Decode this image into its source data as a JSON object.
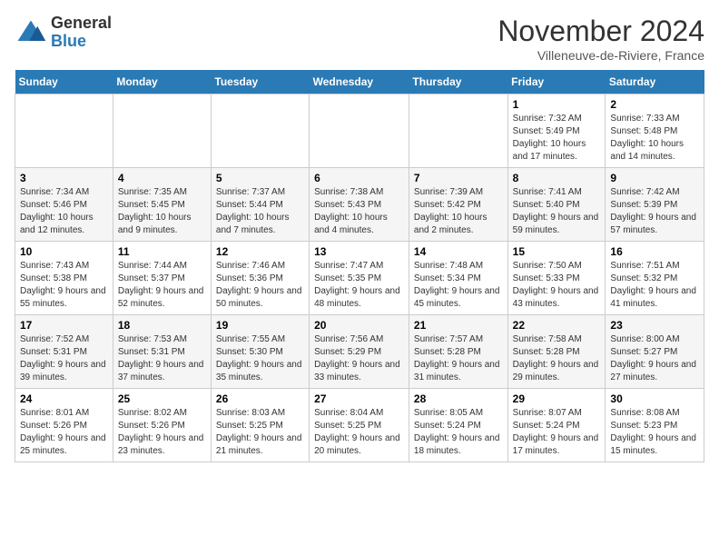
{
  "header": {
    "logo_general": "General",
    "logo_blue": "Blue",
    "month_title": "November 2024",
    "subtitle": "Villeneuve-de-Riviere, France"
  },
  "columns": [
    "Sunday",
    "Monday",
    "Tuesday",
    "Wednesday",
    "Thursday",
    "Friday",
    "Saturday"
  ],
  "weeks": [
    {
      "days": [
        {
          "num": "",
          "info": ""
        },
        {
          "num": "",
          "info": ""
        },
        {
          "num": "",
          "info": ""
        },
        {
          "num": "",
          "info": ""
        },
        {
          "num": "",
          "info": ""
        },
        {
          "num": "1",
          "info": "Sunrise: 7:32 AM\nSunset: 5:49 PM\nDaylight: 10 hours and 17 minutes."
        },
        {
          "num": "2",
          "info": "Sunrise: 7:33 AM\nSunset: 5:48 PM\nDaylight: 10 hours and 14 minutes."
        }
      ]
    },
    {
      "days": [
        {
          "num": "3",
          "info": "Sunrise: 7:34 AM\nSunset: 5:46 PM\nDaylight: 10 hours and 12 minutes."
        },
        {
          "num": "4",
          "info": "Sunrise: 7:35 AM\nSunset: 5:45 PM\nDaylight: 10 hours and 9 minutes."
        },
        {
          "num": "5",
          "info": "Sunrise: 7:37 AM\nSunset: 5:44 PM\nDaylight: 10 hours and 7 minutes."
        },
        {
          "num": "6",
          "info": "Sunrise: 7:38 AM\nSunset: 5:43 PM\nDaylight: 10 hours and 4 minutes."
        },
        {
          "num": "7",
          "info": "Sunrise: 7:39 AM\nSunset: 5:42 PM\nDaylight: 10 hours and 2 minutes."
        },
        {
          "num": "8",
          "info": "Sunrise: 7:41 AM\nSunset: 5:40 PM\nDaylight: 9 hours and 59 minutes."
        },
        {
          "num": "9",
          "info": "Sunrise: 7:42 AM\nSunset: 5:39 PM\nDaylight: 9 hours and 57 minutes."
        }
      ]
    },
    {
      "days": [
        {
          "num": "10",
          "info": "Sunrise: 7:43 AM\nSunset: 5:38 PM\nDaylight: 9 hours and 55 minutes."
        },
        {
          "num": "11",
          "info": "Sunrise: 7:44 AM\nSunset: 5:37 PM\nDaylight: 9 hours and 52 minutes."
        },
        {
          "num": "12",
          "info": "Sunrise: 7:46 AM\nSunset: 5:36 PM\nDaylight: 9 hours and 50 minutes."
        },
        {
          "num": "13",
          "info": "Sunrise: 7:47 AM\nSunset: 5:35 PM\nDaylight: 9 hours and 48 minutes."
        },
        {
          "num": "14",
          "info": "Sunrise: 7:48 AM\nSunset: 5:34 PM\nDaylight: 9 hours and 45 minutes."
        },
        {
          "num": "15",
          "info": "Sunrise: 7:50 AM\nSunset: 5:33 PM\nDaylight: 9 hours and 43 minutes."
        },
        {
          "num": "16",
          "info": "Sunrise: 7:51 AM\nSunset: 5:32 PM\nDaylight: 9 hours and 41 minutes."
        }
      ]
    },
    {
      "days": [
        {
          "num": "17",
          "info": "Sunrise: 7:52 AM\nSunset: 5:31 PM\nDaylight: 9 hours and 39 minutes."
        },
        {
          "num": "18",
          "info": "Sunrise: 7:53 AM\nSunset: 5:31 PM\nDaylight: 9 hours and 37 minutes."
        },
        {
          "num": "19",
          "info": "Sunrise: 7:55 AM\nSunset: 5:30 PM\nDaylight: 9 hours and 35 minutes."
        },
        {
          "num": "20",
          "info": "Sunrise: 7:56 AM\nSunset: 5:29 PM\nDaylight: 9 hours and 33 minutes."
        },
        {
          "num": "21",
          "info": "Sunrise: 7:57 AM\nSunset: 5:28 PM\nDaylight: 9 hours and 31 minutes."
        },
        {
          "num": "22",
          "info": "Sunrise: 7:58 AM\nSunset: 5:28 PM\nDaylight: 9 hours and 29 minutes."
        },
        {
          "num": "23",
          "info": "Sunrise: 8:00 AM\nSunset: 5:27 PM\nDaylight: 9 hours and 27 minutes."
        }
      ]
    },
    {
      "days": [
        {
          "num": "24",
          "info": "Sunrise: 8:01 AM\nSunset: 5:26 PM\nDaylight: 9 hours and 25 minutes."
        },
        {
          "num": "25",
          "info": "Sunrise: 8:02 AM\nSunset: 5:26 PM\nDaylight: 9 hours and 23 minutes."
        },
        {
          "num": "26",
          "info": "Sunrise: 8:03 AM\nSunset: 5:25 PM\nDaylight: 9 hours and 21 minutes."
        },
        {
          "num": "27",
          "info": "Sunrise: 8:04 AM\nSunset: 5:25 PM\nDaylight: 9 hours and 20 minutes."
        },
        {
          "num": "28",
          "info": "Sunrise: 8:05 AM\nSunset: 5:24 PM\nDaylight: 9 hours and 18 minutes."
        },
        {
          "num": "29",
          "info": "Sunrise: 8:07 AM\nSunset: 5:24 PM\nDaylight: 9 hours and 17 minutes."
        },
        {
          "num": "30",
          "info": "Sunrise: 8:08 AM\nSunset: 5:23 PM\nDaylight: 9 hours and 15 minutes."
        }
      ]
    }
  ]
}
